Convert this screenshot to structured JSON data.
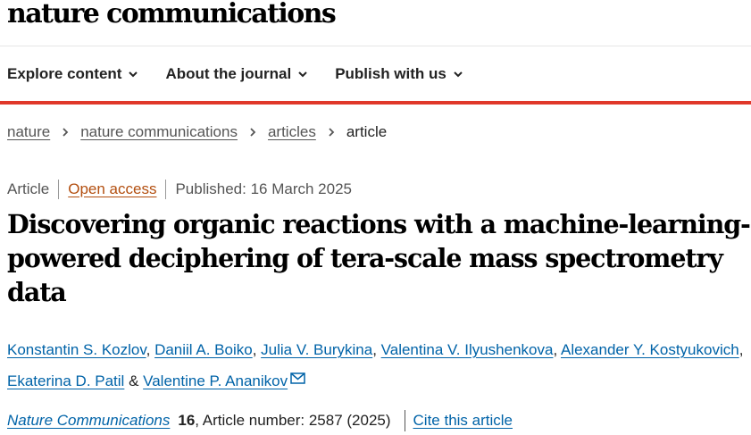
{
  "brand": "nature communications",
  "nav": [
    {
      "label": "Explore content"
    },
    {
      "label": "About the journal"
    },
    {
      "label": "Publish with us"
    }
  ],
  "breadcrumb": {
    "items": [
      "nature",
      "nature communications",
      "articles"
    ],
    "current": "article"
  },
  "meta": {
    "type": "Article",
    "access": "Open access",
    "published": "Published: 16 March 2025"
  },
  "title": "Discovering organic reactions with a machine-learning-powered deciphering of tera-scale mass spectrometry data",
  "authors": [
    "Konstantin S. Kozlov",
    "Daniil A. Boiko",
    "Julia V. Burykina",
    "Valentina V. Ilyushenkova",
    "Alexander Y. Kostyukovich",
    "Ekaterina D. Patil",
    "Valentine P. Ananikov"
  ],
  "author_separators": [
    ", ",
    ", ",
    ", ",
    ", ",
    ", ",
    " & "
  ],
  "citation": {
    "journal": "Nature Communications",
    "volume": "16",
    "article_number": ", Article number: 2587 (2025)",
    "cite_label": "Cite this article"
  },
  "icons": {
    "nav_chevron": "chevron-down-icon",
    "crumb_separator": "chevron-right-icon",
    "corresponding_author": "envelope-icon"
  },
  "colors": {
    "accent_red": "#e0382a",
    "link_blue": "#0063a8",
    "open_access": "#b34f10"
  }
}
